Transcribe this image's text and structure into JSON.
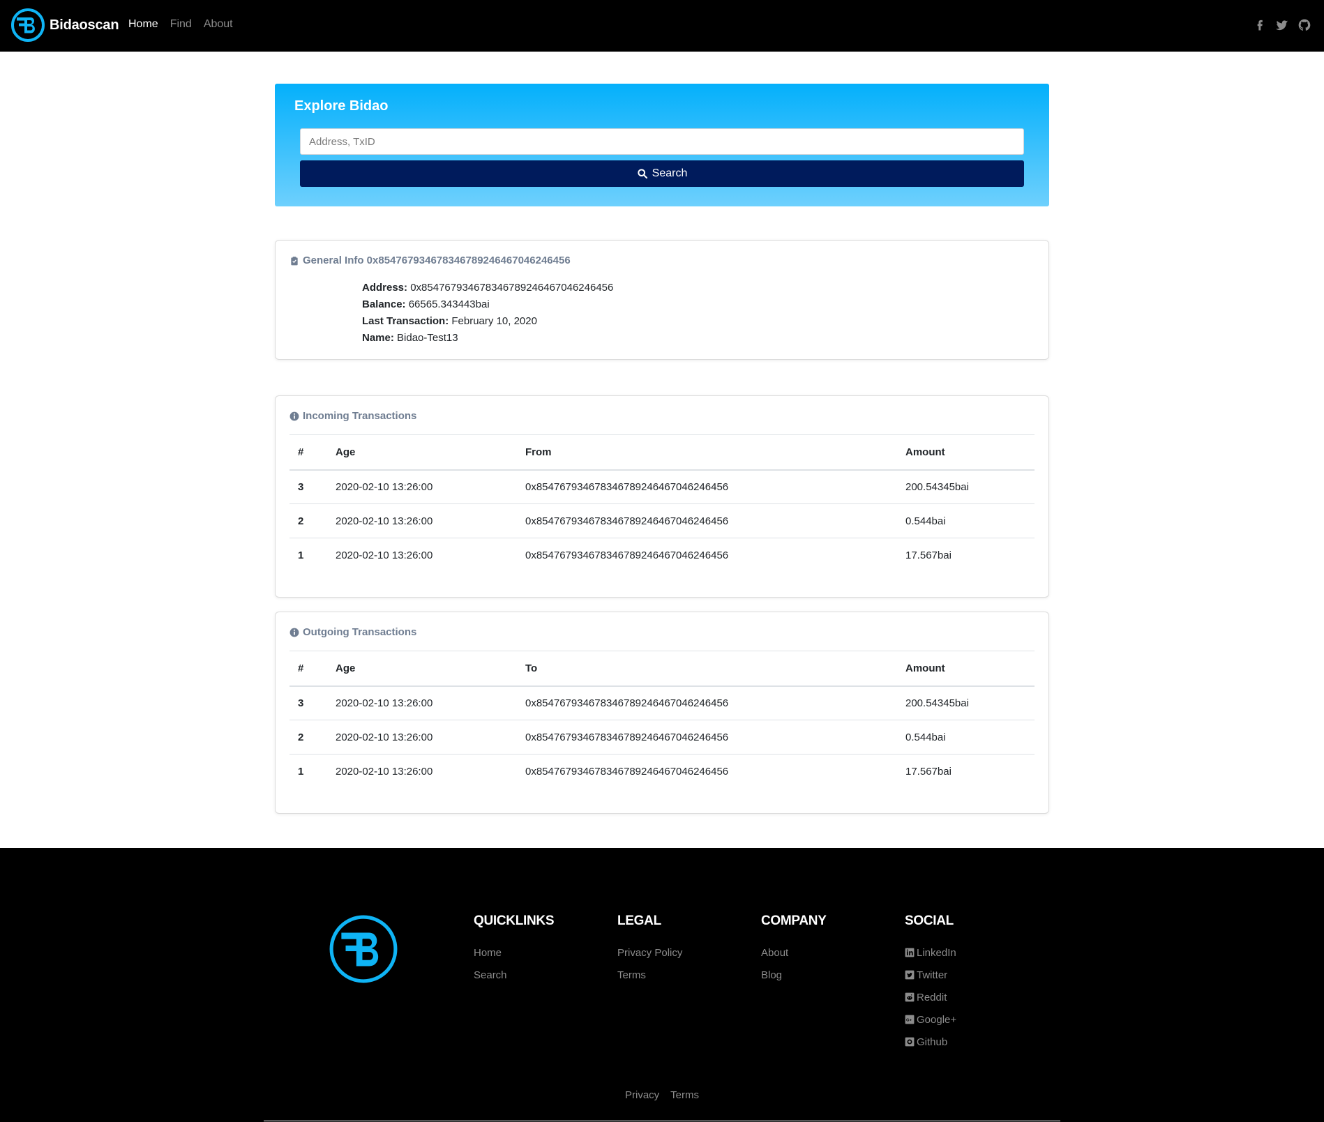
{
  "nav": {
    "brand": "Bidaoscan",
    "links": [
      "Home",
      "Find",
      "About"
    ],
    "social": [
      "facebook-icon",
      "twitter-icon",
      "github-icon"
    ]
  },
  "hero": {
    "title": "Explore Bidao",
    "search_placeholder": "Address, TxID",
    "search_value": "",
    "search_button": "Search"
  },
  "general": {
    "header": "General Info 0x8547679346783467892464670462464 56",
    "header_text": "General Info 0x854767934678346789246467046246456",
    "rows": [
      {
        "label": "Address:",
        "value": "0x854767934678346789246467046246456"
      },
      {
        "label": "Balance:",
        "value": "66565.343443bai"
      },
      {
        "label": "Last Transaction:",
        "value": "February 10, 2020"
      },
      {
        "label": "Name:",
        "value": "Bidao-Test13"
      }
    ]
  },
  "incoming": {
    "title": "Incoming Transactions",
    "headers": [
      "#",
      "Age",
      "From",
      "Amount"
    ],
    "rows": [
      {
        "idx": "3",
        "age": "2020-02-10 13:26:00",
        "addr": "0x854767934678346789246467046246456",
        "amount": "200.54345bai"
      },
      {
        "idx": "2",
        "age": "2020-02-10 13:26:00",
        "addr": "0x854767934678346789246467046246456",
        "amount": "0.544bai"
      },
      {
        "idx": "1",
        "age": "2020-02-10 13:26:00",
        "addr": "0x854767934678346789246467046246456",
        "amount": "17.567bai"
      }
    ]
  },
  "outgoing": {
    "title": "Outgoing Transactions",
    "headers": [
      "#",
      "Age",
      "To",
      "Amount"
    ],
    "rows": [
      {
        "idx": "3",
        "age": "2020-02-10 13:26:00",
        "addr": "0x854767934678346789246467046246456",
        "amount": "200.54345bai"
      },
      {
        "idx": "2",
        "age": "2020-02-10 13:26:00",
        "addr": "0x854767934678346789246467046246456",
        "amount": "0.544bai"
      },
      {
        "idx": "1",
        "age": "2020-02-10 13:26:00",
        "addr": "0x854767934678346789246467046246456",
        "amount": "17.567bai"
      }
    ]
  },
  "footer": {
    "quicklinks": {
      "title": "QUICKLINKS",
      "links": [
        "Home",
        "Search"
      ]
    },
    "legal": {
      "title": "LEGAL",
      "links": [
        "Privacy Policy",
        "Terms"
      ]
    },
    "company": {
      "title": "COMPANY",
      "links": [
        "About",
        "Blog"
      ]
    },
    "social": {
      "title": "SOCIAL",
      "links": [
        {
          "label": "LinkedIn",
          "icon": "linkedin-icon"
        },
        {
          "label": "Twitter",
          "icon": "twitter-icon"
        },
        {
          "label": "Reddit",
          "icon": "reddit-icon"
        },
        {
          "label": "Google+",
          "icon": "google-plus-icon"
        },
        {
          "label": "Github",
          "icon": "github-icon"
        }
      ]
    },
    "bottom_links": [
      "Privacy",
      "Terms"
    ]
  },
  "colors": {
    "navbar": "#000000",
    "accent": "#0fb4f5",
    "hero_top": "#04b0fb",
    "hero_bottom": "#6ed0fd",
    "search_button": "#001b5c",
    "muted_header": "#6f7d91"
  }
}
